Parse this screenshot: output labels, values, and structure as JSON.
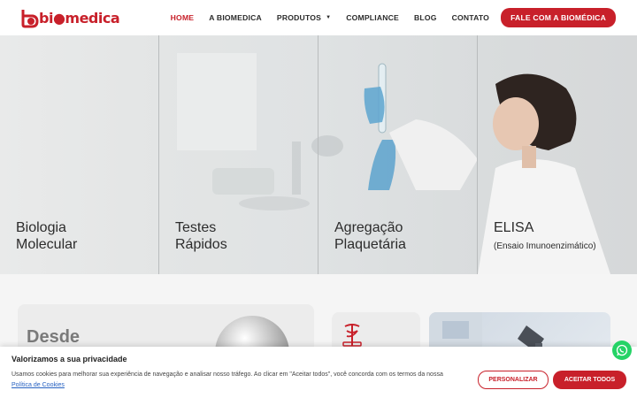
{
  "brand": {
    "logo_text": "bi●medica",
    "accent": "#c8202a"
  },
  "nav": {
    "items": [
      {
        "label": "HOME",
        "active": true
      },
      {
        "label": "A BIOMEDICA",
        "active": false
      },
      {
        "label": "PRODUTOS",
        "active": false,
        "has_dropdown": true
      },
      {
        "label": "COMPLIANCE",
        "active": false
      },
      {
        "label": "BLOG",
        "active": false
      },
      {
        "label": "CONTATO",
        "active": false
      }
    ],
    "cta": "FALE COM A BIOMÉDICA"
  },
  "hero": {
    "panels": [
      {
        "title": "Biologia\nMolecular",
        "subtitle": ""
      },
      {
        "title": "Testes\nRápidos",
        "subtitle": ""
      },
      {
        "title": "Agregação\nPlaquetária",
        "subtitle": ""
      },
      {
        "title": "ELISA",
        "subtitle": "(Ensaio Imunoenzimático)"
      }
    ]
  },
  "section": {
    "card_title": "Desde"
  },
  "cookie": {
    "title": "Valorizamos a sua privacidade",
    "text": "Usamos cookies para melhorar sua experiência de navegação e analisar nosso tráfego. Ao clicar em \"Aceitar todos\", você concorda com os termos da nossa ",
    "link": "Política de Cookies",
    "customize": "PERSONALIZAR",
    "accept": "ACEITAR TODOS"
  },
  "icons": {
    "whatsapp": "whatsapp-icon",
    "caduceus": "caduceus-icon",
    "caret": "chevron-down-icon"
  }
}
